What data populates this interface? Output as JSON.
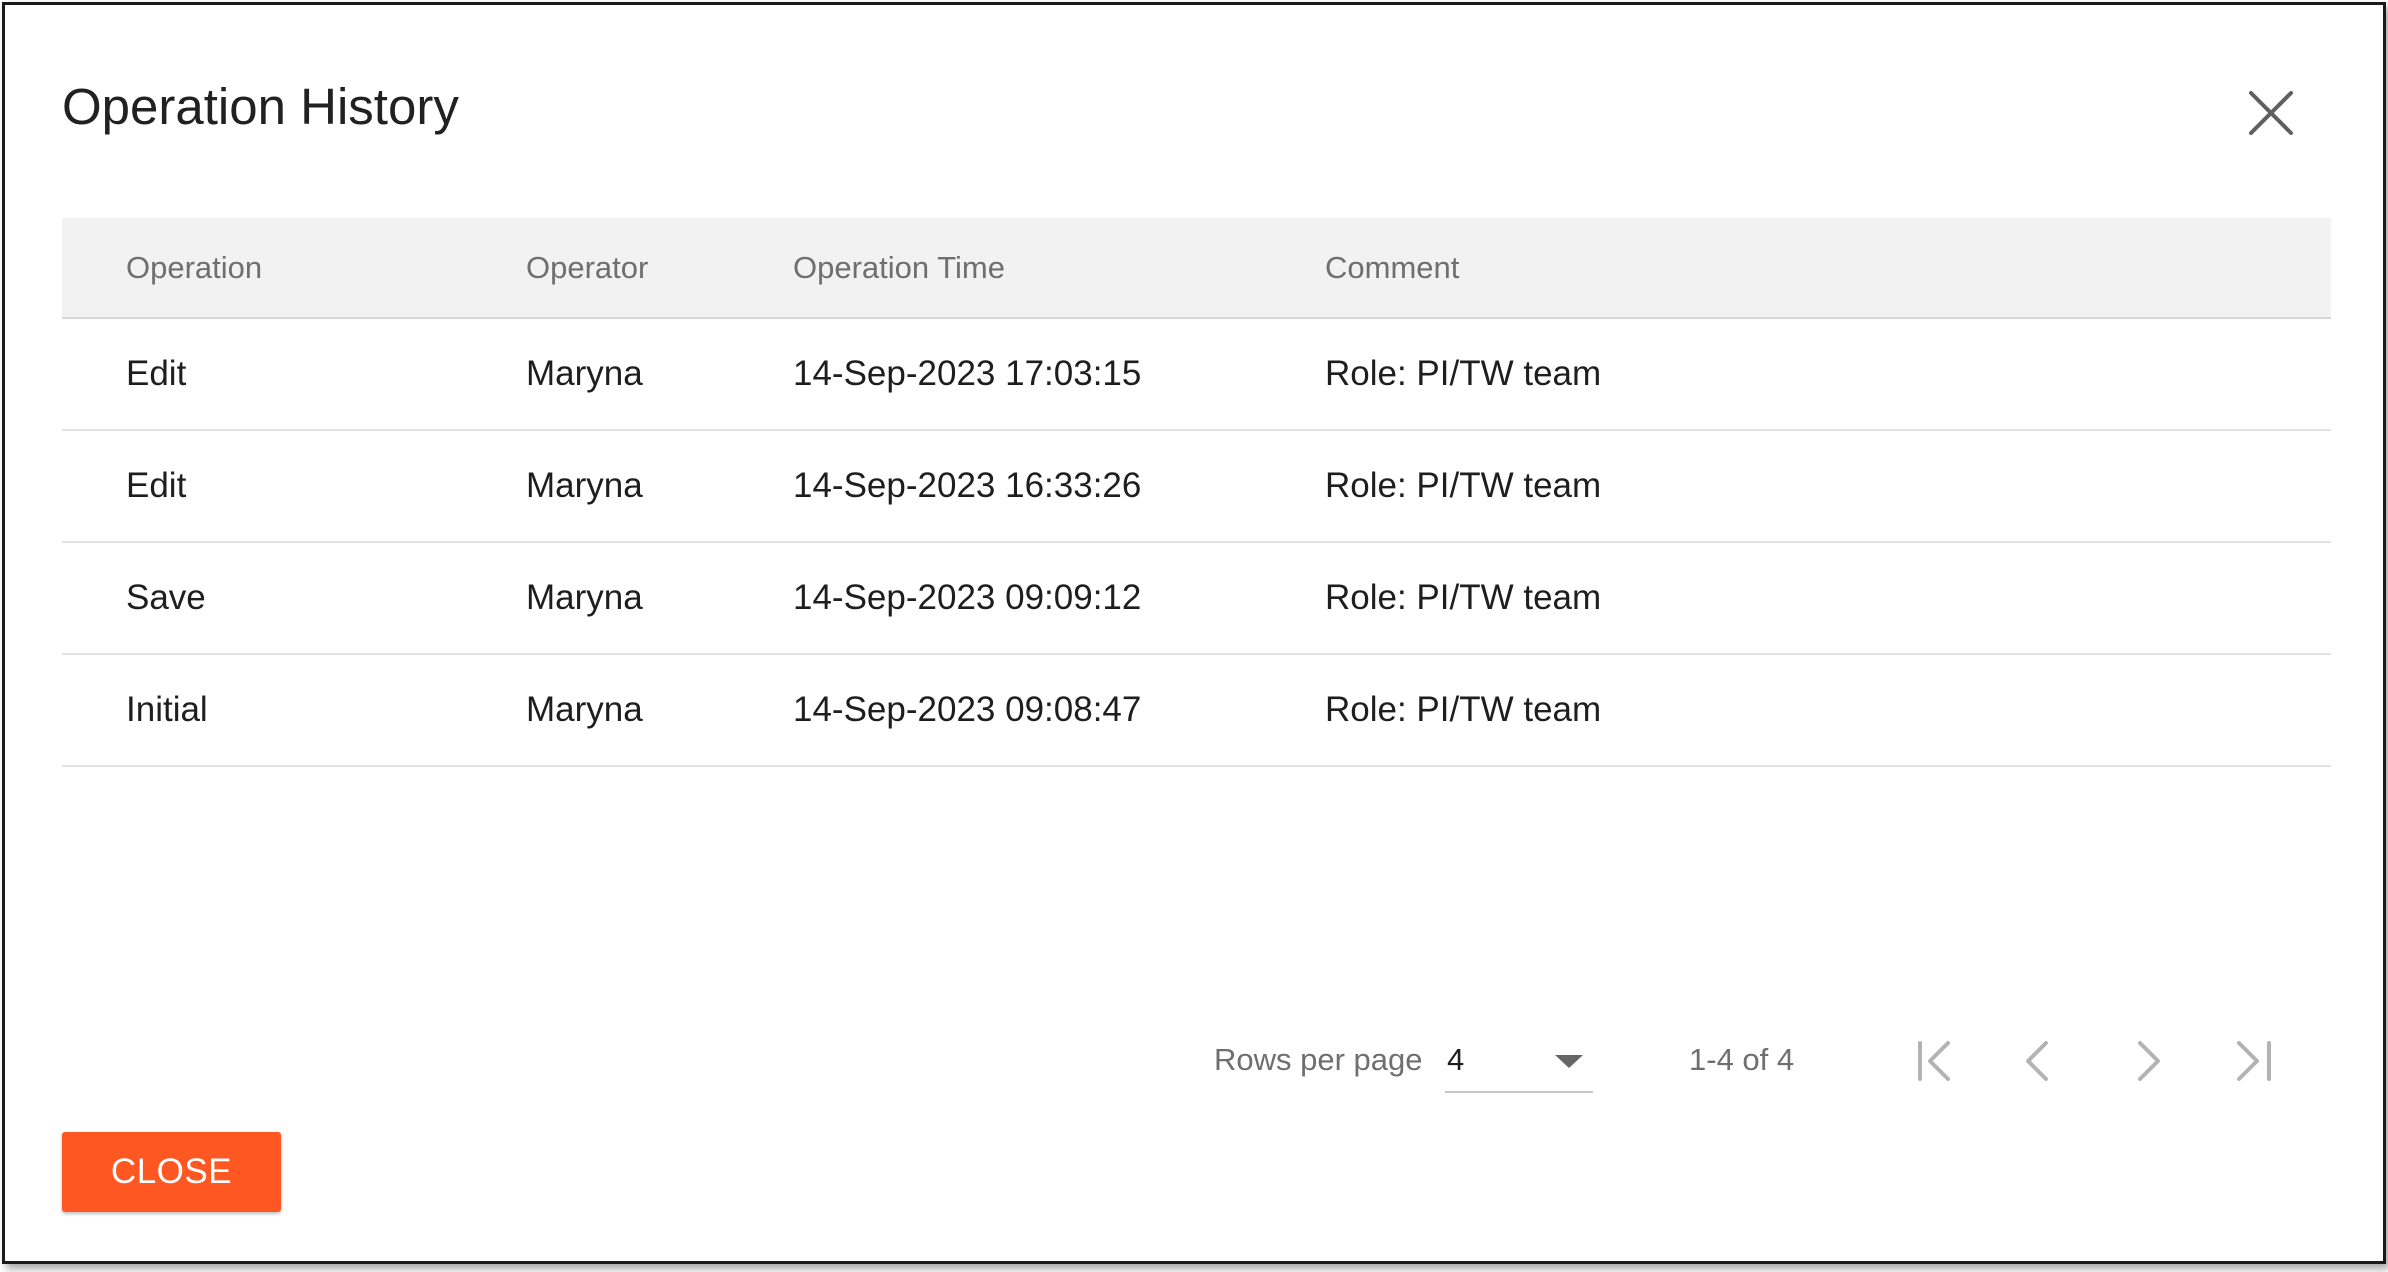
{
  "dialog": {
    "title": "Operation History",
    "close_button_label": "CLOSE"
  },
  "table": {
    "headers": {
      "operation": "Operation",
      "operator": "Operator",
      "operation_time": "Operation Time",
      "comment": "Comment"
    },
    "rows": [
      {
        "operation": "Edit",
        "operator": "Maryna",
        "operation_time": "14-Sep-2023 17:03:15",
        "comment": "Role: PI/TW team"
      },
      {
        "operation": "Edit",
        "operator": "Maryna",
        "operation_time": "14-Sep-2023 16:33:26",
        "comment": "Role: PI/TW team"
      },
      {
        "operation": "Save",
        "operator": "Maryna",
        "operation_time": "14-Sep-2023 09:09:12",
        "comment": "Role: PI/TW team"
      },
      {
        "operation": "Initial",
        "operator": "Maryna",
        "operation_time": "14-Sep-2023 09:08:47",
        "comment": "Role: PI/TW team"
      }
    ]
  },
  "pagination": {
    "rows_per_page_label": "Rows per page",
    "rows_per_page_value": "4",
    "range_text": "1-4 of 4"
  },
  "colors": {
    "accent": "#ff5722",
    "header_background": "#f2f2f2"
  },
  "icons": {
    "close": "close-icon",
    "dropdown": "caret-down-icon",
    "first_page": "first-page-icon",
    "previous_page": "chevron-left-icon",
    "next_page": "chevron-right-icon",
    "last_page": "last-page-icon"
  }
}
